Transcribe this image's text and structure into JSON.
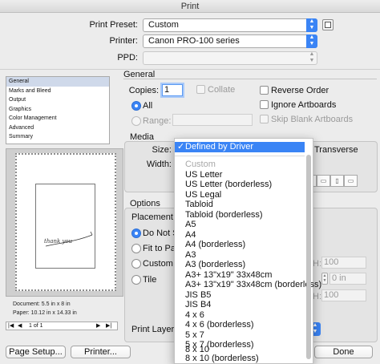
{
  "window": {
    "title": "Print"
  },
  "top": {
    "preset_label": "Print Preset:",
    "preset_value": "Custom",
    "printer_label": "Printer:",
    "printer_value": "Canon PRO-100 series",
    "ppd_label": "PPD:",
    "ppd_value": ""
  },
  "sidebar": {
    "items": [
      "General",
      "Marks and Bleed",
      "Output",
      "Graphics",
      "Color Management",
      "Advanced",
      "Summary"
    ],
    "selected": "General"
  },
  "preview": {
    "handwriting": "thank you",
    "document_info": "Document: 5.5 in x 8 in",
    "paper_info": "Paper: 10.12 in x 14.33 in",
    "page_nav": "1 of 1"
  },
  "general": {
    "section_title": "General",
    "copies_label": "Copies:",
    "copies_value": "1",
    "collate_label": "Collate",
    "reverse_order_label": "Reverse Order",
    "all_label": "All",
    "ignore_artboards_label": "Ignore Artboards",
    "range_label": "Range:",
    "skip_blank_label": "Skip Blank Artboards"
  },
  "media": {
    "section_title": "Media",
    "size_label": "Size:",
    "width_label": "Width:",
    "transverse_label": "Transverse"
  },
  "options": {
    "section_title": "Options",
    "placement_label": "Placement:",
    "do_not_scale_label": "Do Not S",
    "fit_to_page_label": "Fit to Pag",
    "custom_scale_label": "Custom S",
    "tile_label": "Tile",
    "h_field_letter": "H:",
    "h_value": "100",
    "overlap_value": "0 in",
    "scale2_letter": "H:",
    "scale2_value": "100",
    "print_layers_label": "Print Layers:"
  },
  "size_menu": {
    "items": [
      "Defined by Driver",
      "Custom",
      "US Letter",
      "US Letter (borderless)",
      "US Legal",
      "Tabloid",
      "Tabloid (borderless)",
      "A5",
      "A4",
      "A4 (borderless)",
      "A3",
      "A3 (borderless)",
      "A3+ 13\"x19\" 33x48cm",
      "A3+ 13\"x19\" 33x48cm (borderless)",
      "JIS B5",
      "JIS B4",
      "4 x 6",
      "4 x 6 (borderless)",
      "5 x 7",
      "5 x 7 (borderless)",
      "8 x 10",
      "8 x 10 (borderless)"
    ],
    "selected": "Defined by Driver",
    "disabled": "Custom",
    "checkmark": "✓"
  },
  "buttons": {
    "page_setup": "Page Setup...",
    "printer": "Printer...",
    "done": "Done"
  },
  "colors": {
    "accent": "#3a84f5",
    "window_bg": "#ececec"
  }
}
